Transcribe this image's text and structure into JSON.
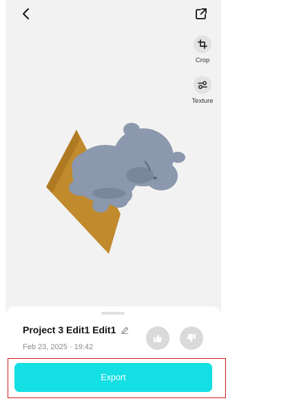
{
  "toolbar": {
    "back_icon": "chevron-left-icon",
    "share_icon": "external-share-icon"
  },
  "tools": [
    {
      "label": "Crop",
      "icon": "crop-icon"
    },
    {
      "label": "Texture",
      "icon": "sliders-icon"
    }
  ],
  "project": {
    "title": "Project 3 Edit1 Edit1",
    "date": "Feb 23, 2025 · 19:42",
    "edit_icon": "pencil-icon"
  },
  "feedback": {
    "like_icon": "thumbs-up-icon",
    "dislike_icon": "thumbs-down-icon"
  },
  "export": {
    "label": "Export"
  },
  "colors": {
    "accent": "#14dfe3",
    "highlight": "#c91b1b",
    "canvas": "#f2f2f2",
    "model": "#8a96aa",
    "base": "#c18a2c"
  }
}
